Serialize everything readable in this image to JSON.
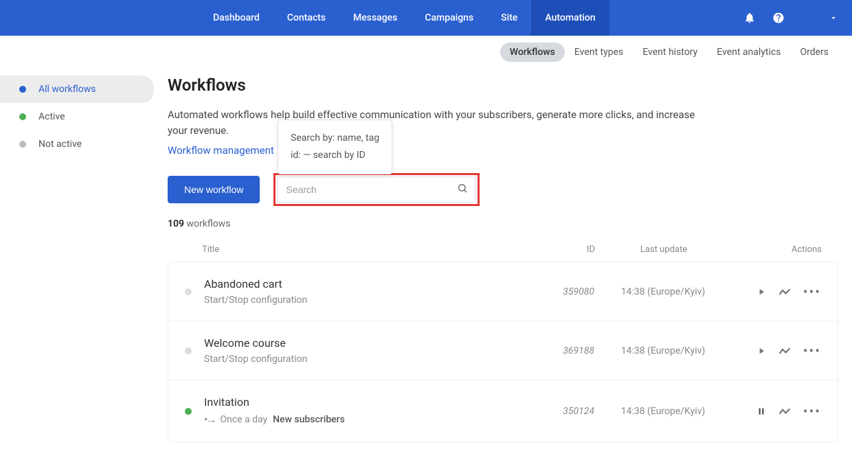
{
  "topnav": {
    "items": [
      {
        "label": "Dashboard"
      },
      {
        "label": "Contacts"
      },
      {
        "label": "Messages"
      },
      {
        "label": "Campaigns"
      },
      {
        "label": "Site"
      },
      {
        "label": "Automation",
        "active": true
      }
    ]
  },
  "subnav": {
    "items": [
      {
        "label": "Workflows",
        "active": true
      },
      {
        "label": "Event types"
      },
      {
        "label": "Event history"
      },
      {
        "label": "Event analytics"
      },
      {
        "label": "Orders"
      }
    ]
  },
  "sidebar": {
    "items": [
      {
        "label": "All workflows",
        "dot": "blue",
        "active": true
      },
      {
        "label": "Active",
        "dot": "green"
      },
      {
        "label": "Not active",
        "dot": "gray"
      }
    ]
  },
  "page": {
    "title": "Workflows",
    "description": "Automated workflows help build effective communication with your subscribers, generate more clicks, and increase your revenue.",
    "link": "Workflow management"
  },
  "controls": {
    "new_button": "New workflow",
    "search_placeholder": "Search",
    "tooltip": {
      "line1": "Search by: name, tag",
      "line2": "id: — search by ID"
    }
  },
  "count": {
    "number": "109",
    "label": "workflows"
  },
  "table": {
    "headers": {
      "title": "Title",
      "id": "ID",
      "update": "Last update",
      "actions": "Actions"
    },
    "rows": [
      {
        "dot": "gray",
        "title": "Abandoned cart",
        "sub": "Start/Stop configuration",
        "id": "359080",
        "update": "14:38 (Europe/Kyiv)",
        "play": true
      },
      {
        "dot": "gray",
        "title": "Welcome course",
        "sub": "Start/Stop configuration",
        "id": "369188",
        "update": "14:38 (Europe/Kyiv)",
        "play": true
      },
      {
        "dot": "green",
        "title": "Invitation",
        "schedule": "Once a day",
        "segment": "New subscribers",
        "id": "350124",
        "update": "14:38 (Europe/Kyiv)",
        "pause": true
      }
    ]
  }
}
